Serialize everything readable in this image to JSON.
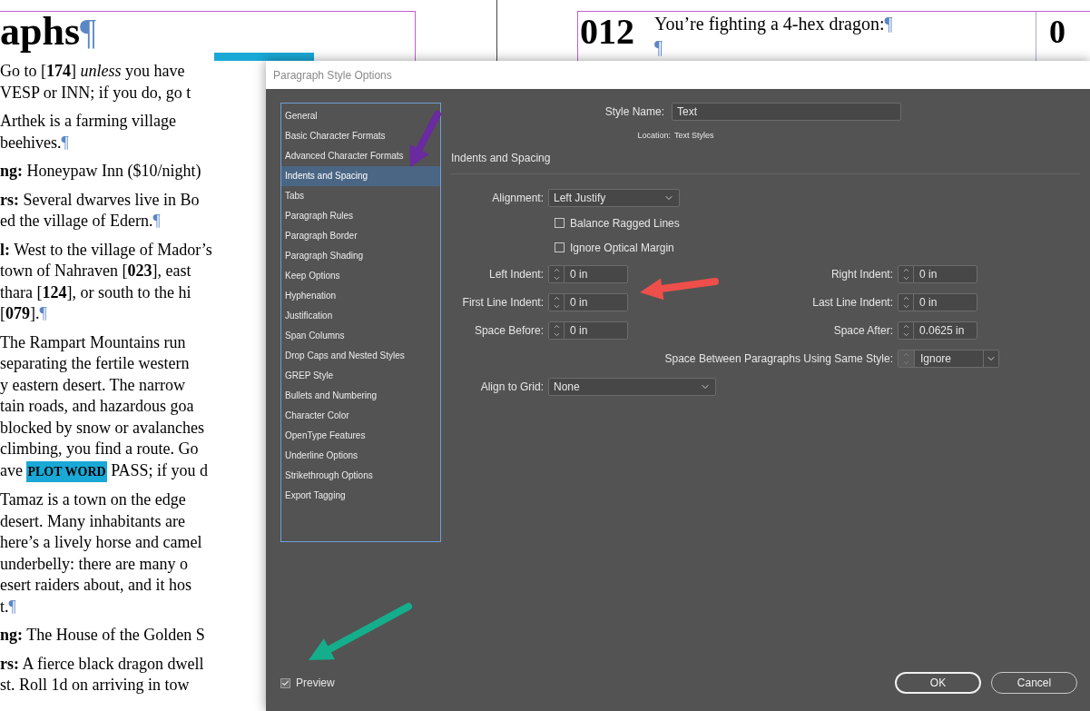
{
  "document": {
    "heading": "aphs",
    "heading_mark": "¶",
    "paragraphs": [
      {
        "lines": [
          {
            "text": "Go to [**174**] *unless* you have"
          },
          {
            "text": "VESP or INN; if you do, go t"
          }
        ]
      },
      {
        "lines": [
          {
            "text": "Arthek is a farming village"
          },
          {
            "text": "beehives.",
            "mark": "¶"
          }
        ]
      },
      {
        "lines": [
          {
            "text": "**ng:** Honeypaw Inn ($10/night)"
          }
        ]
      },
      {
        "lines": [
          {
            "text": "**rs:** Several dwarves live in Bo"
          },
          {
            "text": "ed the village of Edern.",
            "mark": "¶"
          }
        ]
      },
      {
        "lines": [
          {
            "text": "**l:** West to the village of Mador’s"
          },
          {
            "text": "town of Nahraven [**023**], east"
          },
          {
            "text": "thara [**124**], or south to the hi"
          },
          {
            "text": "[**079**].",
            "mark": "¶"
          }
        ]
      },
      {
        "lines": [
          {
            "text": "The Rampart Mountains run"
          },
          {
            "text": "separating the fertile western"
          },
          {
            "text": "y eastern desert. The narrow"
          },
          {
            "text": "tain roads, and hazardous goa"
          },
          {
            "text": "blocked by snow or avalanches"
          },
          {
            "text": "climbing, you find a route. Go"
          },
          {
            "text": "ave ",
            "highlight": "PLOT WORD",
            "after": " PASS; if you d"
          }
        ]
      },
      {
        "lines": [
          {
            "text": "Tamaz is a town on the edge"
          },
          {
            "text": "desert. Many inhabitants are"
          },
          {
            "text": "here’s a lively horse and camel"
          },
          {
            "text": "underbelly: there are many o"
          },
          {
            "text": "esert raiders about, and it hos"
          },
          {
            "text": "t.",
            "mark": "¶"
          }
        ]
      },
      {
        "lines": [
          {
            "text": "**ng:** The House of the Golden S"
          }
        ]
      },
      {
        "lines": [
          {
            "text": "**rs:** A fierce black dragon dwell"
          },
          {
            "text": "st. Roll 1d on arriving in tow"
          }
        ]
      }
    ],
    "right_page": {
      "number": "012",
      "lines": [
        {
          "text": "You’re fighting a 4-hex dragon:",
          "mark": "¶"
        },
        {
          "mark": "¶"
        }
      ],
      "next_number": "0"
    }
  },
  "dialog": {
    "title": "Paragraph Style Options",
    "sidebar": {
      "items": [
        {
          "label": "General",
          "selected": false
        },
        {
          "label": "Basic Character Formats",
          "selected": false
        },
        {
          "label": "Advanced Character Formats",
          "selected": false
        },
        {
          "label": "Indents and Spacing",
          "selected": true
        },
        {
          "label": "Tabs",
          "selected": false
        },
        {
          "label": "Paragraph Rules",
          "selected": false
        },
        {
          "label": "Paragraph Border",
          "selected": false
        },
        {
          "label": "Paragraph Shading",
          "selected": false
        },
        {
          "label": "Keep Options",
          "selected": false
        },
        {
          "label": "Hyphenation",
          "selected": false
        },
        {
          "label": "Justification",
          "selected": false
        },
        {
          "label": "Span Columns",
          "selected": false
        },
        {
          "label": "Drop Caps and Nested Styles",
          "selected": false
        },
        {
          "label": "GREP Style",
          "selected": false
        },
        {
          "label": "Bullets and Numbering",
          "selected": false
        },
        {
          "label": "Character Color",
          "selected": false
        },
        {
          "label": "OpenType Features",
          "selected": false
        },
        {
          "label": "Underline Options",
          "selected": false
        },
        {
          "label": "Strikethrough Options",
          "selected": false
        },
        {
          "label": "Export Tagging",
          "selected": false
        }
      ]
    },
    "style_name": {
      "label": "Style Name:",
      "value": "Text"
    },
    "location": {
      "label": "Location:",
      "value": "Text Styles"
    },
    "section_title": "Indents and Spacing",
    "alignment": {
      "label": "Alignment:",
      "value": "Left Justify"
    },
    "checkboxes": [
      {
        "label": "Balance Ragged Lines",
        "checked": false
      },
      {
        "label": "Ignore Optical Margin",
        "checked": false
      }
    ],
    "spacing_rows": [
      {
        "left": {
          "label": "Left Indent:",
          "value": "0 in"
        },
        "right": {
          "label": "Right Indent:",
          "value": "0 in"
        }
      },
      {
        "left": {
          "label": "First Line Indent:",
          "value": "0 in"
        },
        "right": {
          "label": "Last Line Indent:",
          "value": "0 in"
        }
      },
      {
        "left": {
          "label": "Space Before:",
          "value": "0 in"
        },
        "right": {
          "label": "Space After:",
          "value": "0.0625 in"
        }
      }
    ],
    "space_between": {
      "label": "Space Between Paragraphs Using Same Style:",
      "value": "Ignore"
    },
    "align_to_grid": {
      "label": "Align to Grid:",
      "value": "None"
    },
    "preview": {
      "label": "Preview",
      "checked": true
    },
    "buttons": [
      {
        "label": "OK",
        "kind": "primary"
      },
      {
        "label": "Cancel",
        "kind": "secondary"
      }
    ]
  }
}
